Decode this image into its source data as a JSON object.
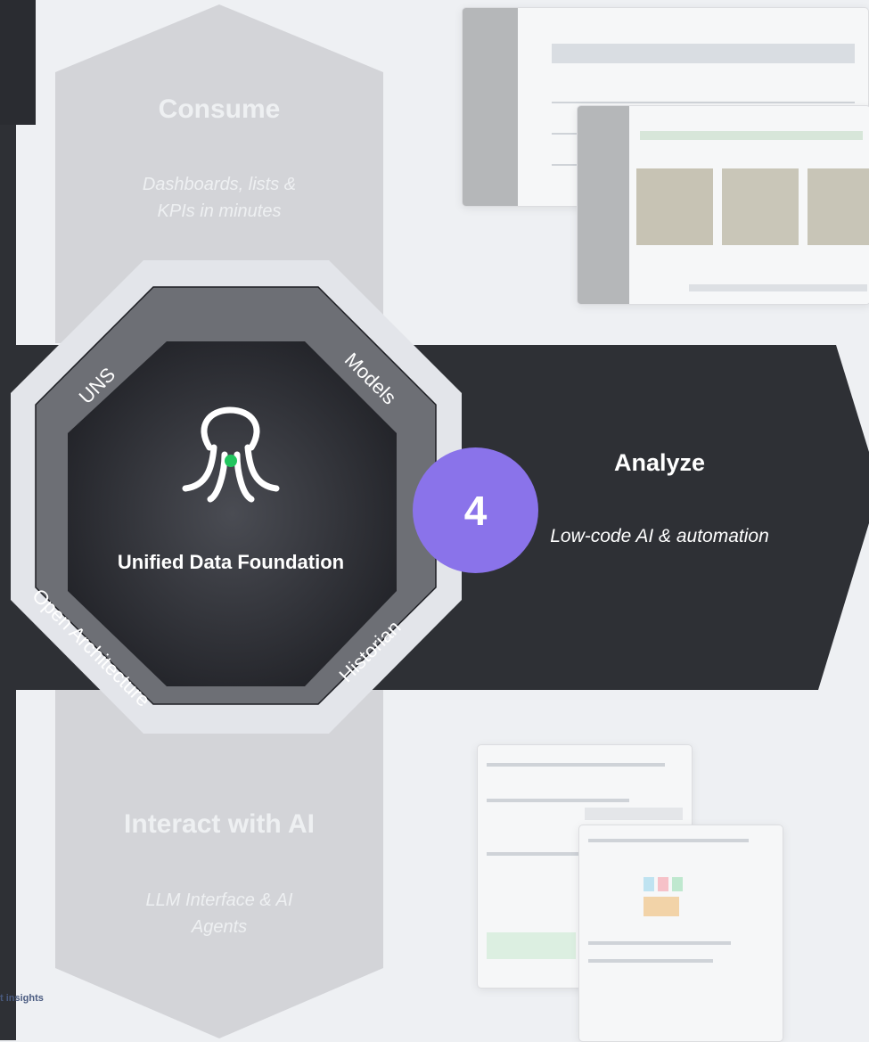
{
  "stages": {
    "consume": {
      "title": "Consume",
      "subtitle_line1": "Dashboards, lists &",
      "subtitle_line2": "KPIs in minutes"
    },
    "analyze": {
      "number": "4",
      "title": "Analyze",
      "subtitle": "Low-code AI & automation"
    },
    "interact": {
      "title": "Interact with AI",
      "subtitle_line1": "LLM Interface & AI",
      "subtitle_line2": "Agents"
    }
  },
  "foundation": {
    "label": "Unified Data Foundation",
    "ring_labels": {
      "uns": "UNS",
      "models": "Models",
      "open_architecture": "Open Architecture",
      "historian": "Historian"
    }
  },
  "edge_text": "t insights",
  "colors": {
    "band": "#2e3035",
    "badge": "#8a73ea",
    "hex": "#d3d4d8",
    "octagon_ring": "#6d6f75",
    "logo_dot": "#22c55e"
  }
}
